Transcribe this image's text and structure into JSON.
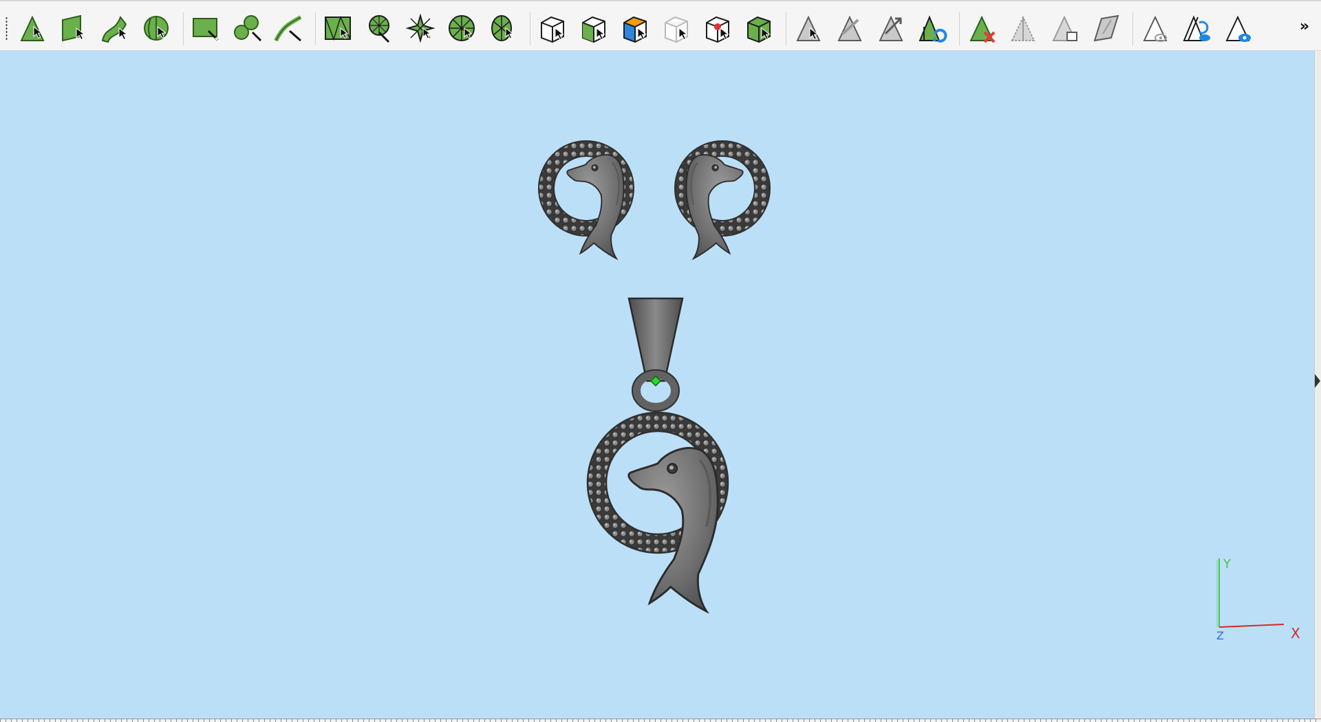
{
  "toolbar": {
    "overflow_label": "»",
    "groups": [
      {
        "name": "select-basic",
        "tools": [
          "select-pointer",
          "select-face",
          "select-curve",
          "select-solid"
        ]
      },
      {
        "name": "select-regions",
        "tools": [
          "select-rectangle",
          "select-blob",
          "select-path"
        ]
      },
      {
        "name": "select-patterns",
        "tools": [
          "select-mesh-pattern",
          "select-radial-cluster",
          "select-star-pattern",
          "select-wheel-pattern",
          "select-fan-pattern"
        ]
      },
      {
        "name": "select-boxes",
        "tools": [
          "select-box-outline",
          "select-box-green",
          "select-box-colored",
          "select-box-ghost",
          "select-box-red-point",
          "select-box-filled"
        ]
      },
      {
        "name": "visibility",
        "tools": [
          "pointer-gray",
          "pointer-split-gray",
          "pointer-split-arrow",
          "pointer-refresh"
        ]
      },
      {
        "name": "delete-tools",
        "tools": [
          "delete-selection",
          "cut-half",
          "paste-copy",
          "flat-panel"
        ]
      },
      {
        "name": "view-tools",
        "tools": [
          "hide-toggle",
          "show-cycle",
          "show-eye"
        ]
      }
    ]
  },
  "viewport": {
    "background_color": "#bcdff8",
    "model_color": "#6e6e6e",
    "pivot_color": "#22dd22",
    "axis": {
      "x_label": "X",
      "y_label": "Y",
      "z_label": "Z",
      "x_color": "#d62828",
      "y_color": "#3fc94a",
      "z_color": "#2a6fd6"
    }
  }
}
